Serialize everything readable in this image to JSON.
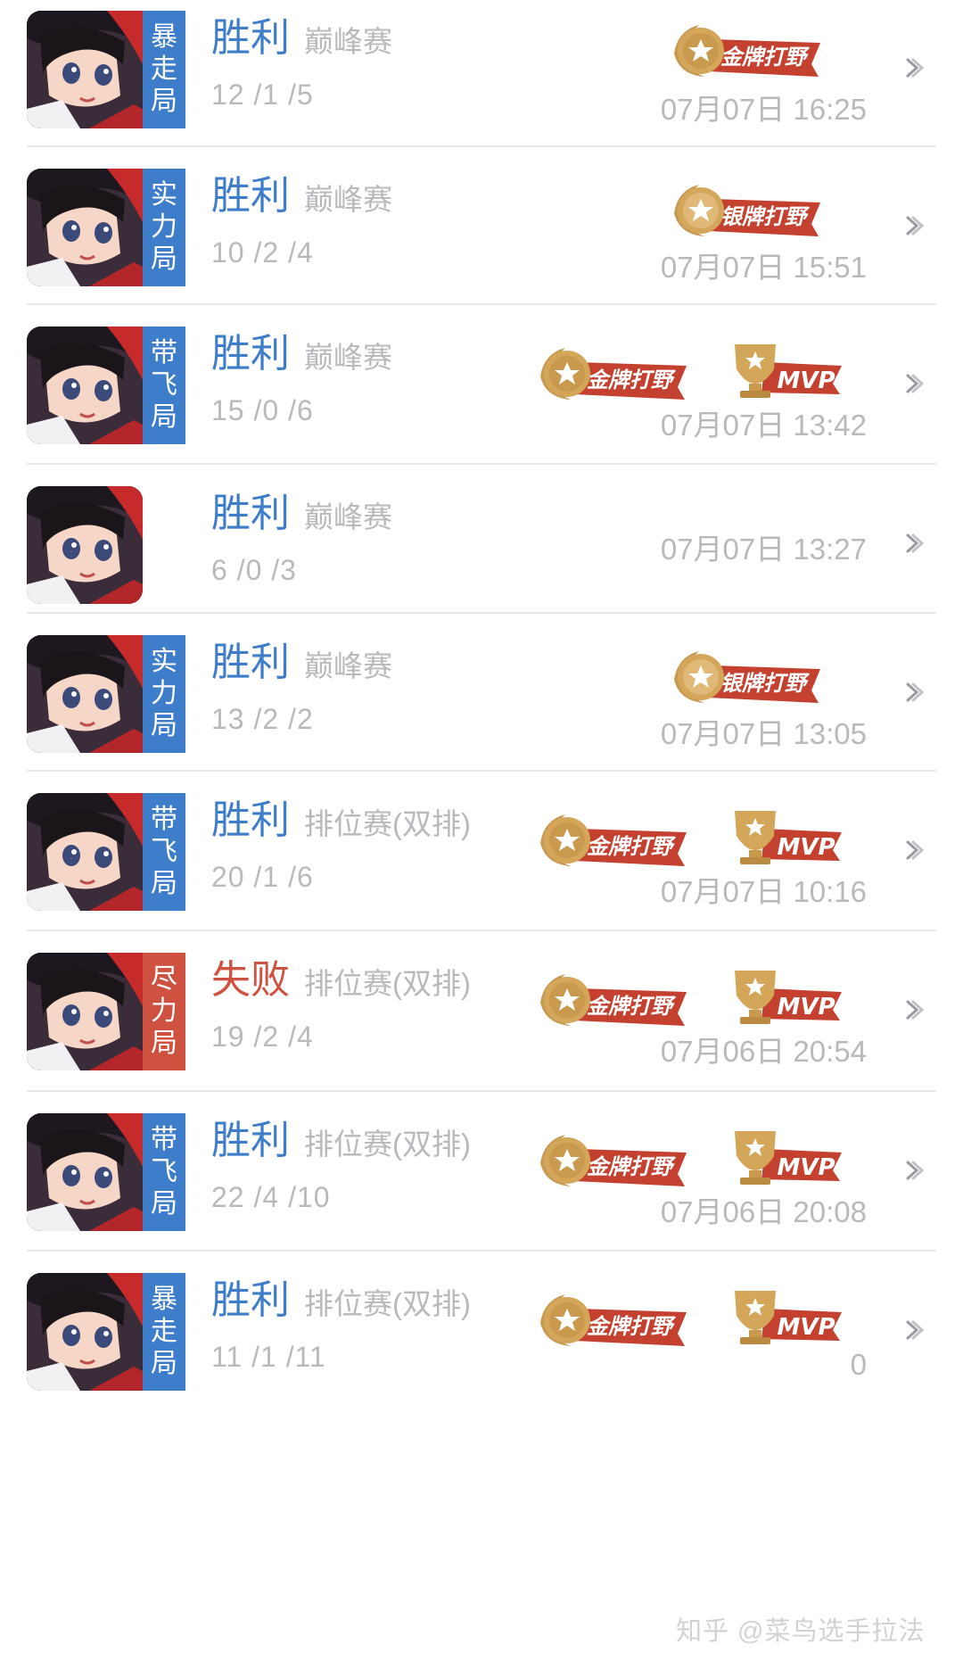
{
  "colors": {
    "win": "#3e7dca",
    "loss": "#cf5140",
    "tag_blue": "#3e7dca",
    "tag_red": "#cf5140",
    "muted": "#b9b9bd",
    "gold_badge": "#c0392b",
    "divider": "#e8e8e8"
  },
  "matches": [
    {
      "tag": [
        "暴",
        "走",
        "局"
      ],
      "tag_color": "blue",
      "result": "胜利",
      "mode": "巅峰赛",
      "kda": "12 /1 /5",
      "badges": [
        "金牌打野"
      ],
      "time": "07月07日 16:25"
    },
    {
      "tag": [
        "实",
        "力",
        "局"
      ],
      "tag_color": "blue",
      "result": "胜利",
      "mode": "巅峰赛",
      "kda": "10 /2 /4",
      "badges": [
        "银牌打野"
      ],
      "time": "07月07日 15:51"
    },
    {
      "tag": [
        "带",
        "飞",
        "局"
      ],
      "tag_color": "blue",
      "result": "胜利",
      "mode": "巅峰赛",
      "kda": "15 /0 /6",
      "badges": [
        "金牌打野",
        "MVP"
      ],
      "time": "07月07日 13:42"
    },
    {
      "tag": [],
      "tag_color": "none",
      "result": "胜利",
      "mode": "巅峰赛",
      "kda": "6 /0 /3",
      "badges": [],
      "time": "07月07日 13:27"
    },
    {
      "tag": [
        "实",
        "力",
        "局"
      ],
      "tag_color": "blue",
      "result": "胜利",
      "mode": "巅峰赛",
      "kda": "13 /2 /2",
      "badges": [
        "银牌打野"
      ],
      "time": "07月07日 13:05"
    },
    {
      "tag": [
        "带",
        "飞",
        "局"
      ],
      "tag_color": "blue",
      "result": "胜利",
      "mode": "排位赛(双排)",
      "kda": "20 /1 /6",
      "badges": [
        "金牌打野",
        "MVP"
      ],
      "time": "07月07日 10:16"
    },
    {
      "tag": [
        "尽",
        "力",
        "局"
      ],
      "tag_color": "red",
      "result": "失败",
      "mode": "排位赛(双排)",
      "kda": "19 /2 /4",
      "badges": [
        "金牌打野",
        "MVP"
      ],
      "time": "07月06日 20:54"
    },
    {
      "tag": [
        "带",
        "飞",
        "局"
      ],
      "tag_color": "blue",
      "result": "胜利",
      "mode": "排位赛(双排)",
      "kda": "22 /4 /10",
      "badges": [
        "金牌打野",
        "MVP"
      ],
      "time": "07月06日 20:08"
    },
    {
      "tag": [
        "暴",
        "走",
        "局"
      ],
      "tag_color": "blue",
      "result": "胜利",
      "mode": "排位赛(双排)",
      "kda": "11 /1 /11",
      "badges": [
        "金牌打野",
        "MVP"
      ],
      "time": "0"
    }
  ],
  "icons": {
    "chevron": "chevron-right-icon",
    "medal": "star-medal-icon",
    "trophy": "trophy-icon"
  },
  "watermark": "知乎 @菜鸟选手拉法"
}
